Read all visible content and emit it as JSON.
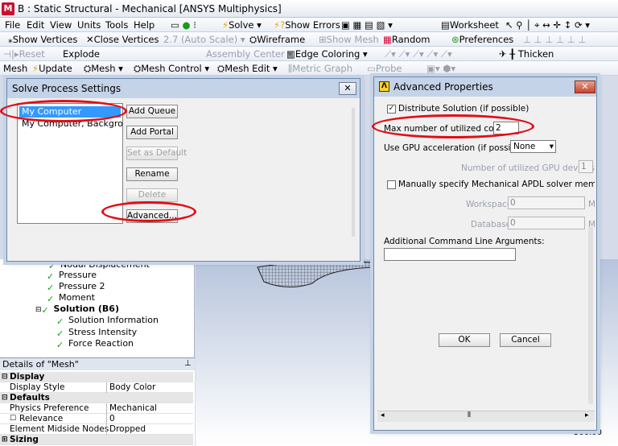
{
  "window": {
    "title": "B : Static Structural - Mechanical [ANSYS Multiphysics]",
    "logo_letter": "M"
  },
  "menubar": {
    "items": [
      "File",
      "Edit",
      "View",
      "Units",
      "Tools",
      "Help"
    ],
    "solve_label": "Solve",
    "show_errors_label": "Show Errors",
    "worksheet_label": "Worksheet"
  },
  "toolbar2": {
    "show_vertices": "Show Vertices",
    "close_vertices": "Close Vertices",
    "auto_scale": "2.7 (Auto Scale)",
    "wireframe": "Wireframe",
    "show_mesh": "Show Mesh",
    "random": "Random",
    "preferences": "Preferences"
  },
  "toolbar3": {
    "reset": "Reset",
    "explode": "Explode",
    "assembly_center": "Assembly Center",
    "edge_coloring": "Edge Coloring",
    "thicken": "Thicken"
  },
  "toolbar4": {
    "mesh_label": "Mesh",
    "update": "Update",
    "mesh_menu": "Mesh",
    "mesh_control": "Mesh Control",
    "mesh_edit": "Mesh Edit",
    "metric_graph": "Metric Graph",
    "probe": "Probe"
  },
  "tree": {
    "items": [
      {
        "label": "Nodal Displacement"
      },
      {
        "label": "Pressure"
      },
      {
        "label": "Pressure 2"
      },
      {
        "label": "Moment"
      },
      {
        "label": "Solution (B6)"
      },
      {
        "label": "Solution Information"
      },
      {
        "label": "Stress Intensity"
      },
      {
        "label": "Force Reaction"
      }
    ]
  },
  "details": {
    "header": "Details of \"Mesh\"",
    "rows": [
      {
        "key": "Display",
        "value": "",
        "group": true
      },
      {
        "key": "Display Style",
        "value": "Body Color"
      },
      {
        "key": "Defaults",
        "value": "",
        "group": true
      },
      {
        "key": "Physics Preference",
        "value": "Mechanical"
      },
      {
        "key": "Relevance",
        "value": "0"
      },
      {
        "key": "Element Midside Nodes",
        "value": "Dropped"
      },
      {
        "key": "Sizing",
        "value": "",
        "group": true
      }
    ]
  },
  "graphics": {
    "scale_label": "500.00"
  },
  "solve_dialog": {
    "title": "Solve Process Settings",
    "list": [
      "My Computer",
      "My Computer, Background"
    ],
    "buttons": {
      "add_queue": "Add Queue",
      "add_portal": "Add Portal",
      "set_default": "Set as Default",
      "rename": "Rename",
      "delete": "Delete",
      "advanced": "Advanced..."
    }
  },
  "adv_dialog": {
    "title": "Advanced Properties",
    "distribute_label": "Distribute Solution (if possible)",
    "max_cores_label": "Max number of utilized cores:",
    "max_cores_value": "2",
    "gpu_label": "Use GPU acceleration (if possible)",
    "gpu_value": "None",
    "gpu_devices_label": "Number of utilized GPU devices:",
    "gpu_devices_value": "1",
    "memory_label": "Manually specify Mechanical APDL solver memory settings",
    "workspace_label": "Workspace:",
    "workspace_value": "0",
    "database_label": "Database:",
    "database_value": "0",
    "unit_m": "M",
    "cmd_label": "Additional Command Line Arguments:",
    "cmd_value": "",
    "ok": "OK",
    "cancel": "Cancel"
  },
  "colors": {
    "highlight_ring": "#e00f17",
    "selection": "#3399ff",
    "dialog_frame": "#c4d3e8"
  }
}
